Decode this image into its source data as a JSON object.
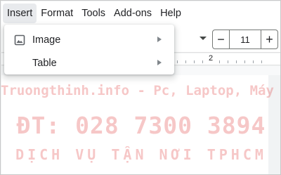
{
  "menubar": {
    "items": [
      "Insert",
      "Format",
      "Tools",
      "Add-ons",
      "Help"
    ],
    "active": "Insert"
  },
  "toolbar": {
    "font_size": "11",
    "minus_label": "−",
    "plus_label": "+"
  },
  "ruler": {
    "marker": "2"
  },
  "dropdown": {
    "items": [
      {
        "label": "Image",
        "icon": "image-icon",
        "has_submenu": true
      },
      {
        "label": "Table",
        "icon": null,
        "has_submenu": true
      }
    ]
  },
  "watermark": {
    "line1": "Truongthinh.info - Pc, Laptop, Máy In",
    "line2": "ĐT: 028 7300 3894",
    "line3": "DỊCH VỤ TẬN NƠI TPHCM"
  },
  "colors": {
    "text": "#202124",
    "active_menu_bg": "#e8eaed",
    "watermark": "#dc2828"
  }
}
